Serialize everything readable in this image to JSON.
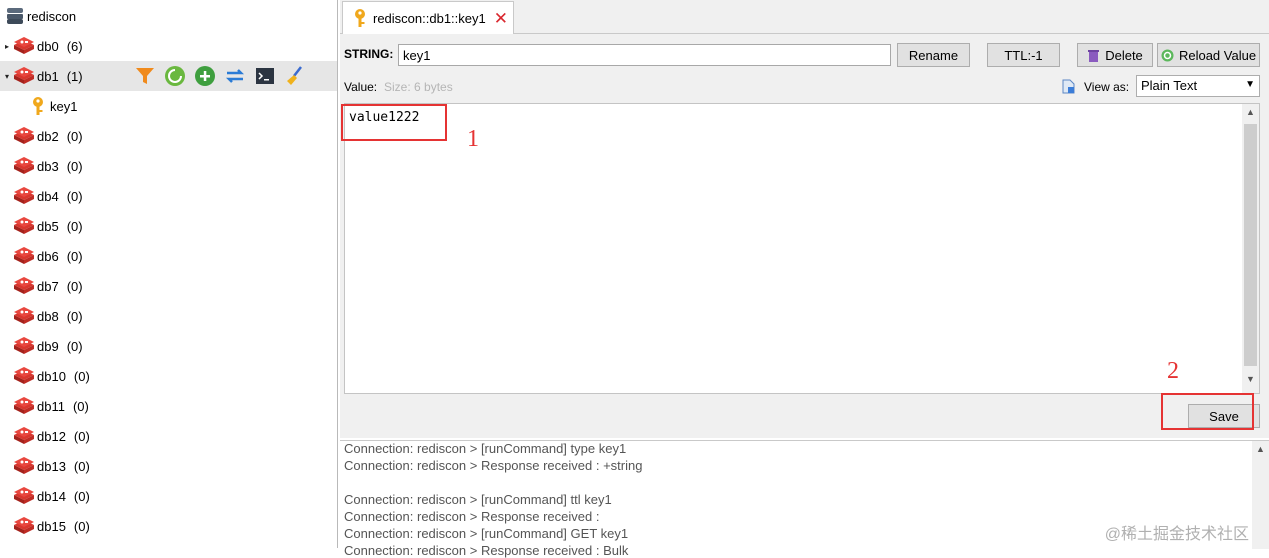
{
  "tree": {
    "server_name": "rediscon",
    "databases": [
      {
        "name": "db0",
        "count": "(6)",
        "expanded": false
      },
      {
        "name": "db1",
        "count": "(1)",
        "expanded": true
      },
      {
        "name": "db2",
        "count": "(0)"
      },
      {
        "name": "db3",
        "count": "(0)"
      },
      {
        "name": "db4",
        "count": "(0)"
      },
      {
        "name": "db5",
        "count": "(0)"
      },
      {
        "name": "db6",
        "count": "(0)"
      },
      {
        "name": "db7",
        "count": "(0)"
      },
      {
        "name": "db8",
        "count": "(0)"
      },
      {
        "name": "db9",
        "count": "(0)"
      },
      {
        "name": "db10",
        "count": "(0)"
      },
      {
        "name": "db11",
        "count": "(0)"
      },
      {
        "name": "db12",
        "count": "(0)"
      },
      {
        "name": "db13",
        "count": "(0)"
      },
      {
        "name": "db14",
        "count": "(0)"
      },
      {
        "name": "db15",
        "count": "(0)"
      }
    ],
    "key_item": "key1",
    "toolbar_icons": [
      "filter-icon",
      "reload-icon",
      "add-icon",
      "refresh-icon",
      "console-icon",
      "broom-icon"
    ]
  },
  "tab": {
    "label": "rediscon::db1::key1",
    "close": "✕"
  },
  "editor": {
    "type_label": "STRING:",
    "key_value": "key1",
    "rename_label": "Rename",
    "ttl_label": "TTL:-1",
    "delete_label": "Delete",
    "reload_label": "Reload Value",
    "value_label": "Value:",
    "size_label": "Size: 6 bytes",
    "viewas_label": "View as:",
    "viewas_selected": "Plain Text",
    "content": "value1222",
    "save_label": "Save"
  },
  "annotations": {
    "one": "1",
    "two": "2"
  },
  "log": {
    "lines": [
      "Connection: rediscon > [runCommand] type key1",
      "Connection: rediscon > Response received : +string",
      "",
      "Connection: rediscon > [runCommand] ttl key1",
      "Connection: rediscon > Response received :",
      "Connection: rediscon > [runCommand] GET key1",
      "Connection: rediscon > Response received : Bulk"
    ]
  },
  "watermark": "@稀土掘金技术社区",
  "colors": {
    "accent_red": "#e53333",
    "redis_red": "#c9302c",
    "panel_bg": "#f0f0f0"
  }
}
